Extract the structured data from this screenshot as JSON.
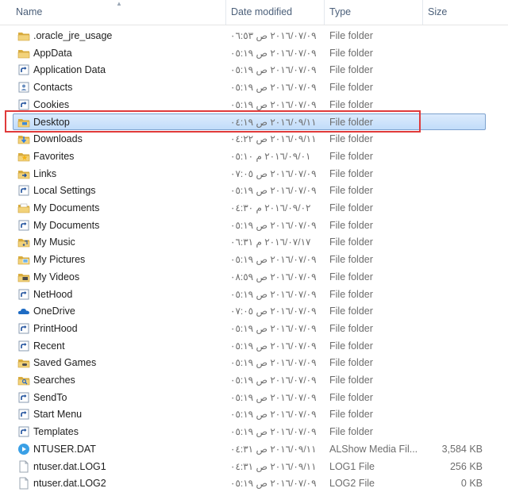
{
  "columns": {
    "name": "Name",
    "date": "Date modified",
    "type": "Type",
    "size": "Size"
  },
  "colors": {
    "annotation": "#e03a3a",
    "selection": "#c1dcfa",
    "folder": "#e8c462"
  },
  "files": [
    {
      "icon": "folder-icon",
      "name": ".oracle_jre_usage",
      "date": "٢٠١٦/٠٧/٠٩ ص ٠٦:٥٣",
      "type": "File folder",
      "size": ""
    },
    {
      "icon": "folder-icon",
      "name": "AppData",
      "date": "٢٠١٦/٠٧/٠٩ ص ٠٥:١٩",
      "type": "File folder",
      "size": ""
    },
    {
      "icon": "shortcut-folder-icon",
      "name": "Application Data",
      "date": "٢٠١٦/٠٧/٠٩ ص ٠٥:١٩",
      "type": "File folder",
      "size": ""
    },
    {
      "icon": "contacts-folder-icon",
      "name": "Contacts",
      "date": "٢٠١٦/٠٧/٠٩ ص ٠٥:١٩",
      "type": "File folder",
      "size": ""
    },
    {
      "icon": "shortcut-folder-icon",
      "name": "Cookies",
      "date": "٢٠١٦/٠٧/٠٩ ص ٠٥:١٩",
      "type": "File folder",
      "size": ""
    },
    {
      "icon": "desktop-folder-icon",
      "name": "Desktop",
      "date": "٢٠١٦/٠٩/١١ ص ٠٤:١٩",
      "type": "File folder",
      "size": "",
      "selected": true
    },
    {
      "icon": "downloads-folder-icon",
      "name": "Downloads",
      "date": "٢٠١٦/٠٩/١١ ص ٠٤:٢٢",
      "type": "File folder",
      "size": ""
    },
    {
      "icon": "favorites-folder-icon",
      "name": "Favorites",
      "date": "٢٠١٦/٠٩/٠١ م ٠٥:١٠",
      "type": "File folder",
      "size": ""
    },
    {
      "icon": "links-folder-icon",
      "name": "Links",
      "date": "٢٠١٦/٠٧/٠٩ ص ٠٧:٠٥",
      "type": "File folder",
      "size": ""
    },
    {
      "icon": "shortcut-folder-icon",
      "name": "Local Settings",
      "date": "٢٠١٦/٠٧/٠٩ ص ٠٥:١٩",
      "type": "File folder",
      "size": ""
    },
    {
      "icon": "documents-folder-icon",
      "name": "My Documents",
      "date": "٢٠١٦/٠٩/٠٢ م ٠٤:٣٠",
      "type": "File folder",
      "size": ""
    },
    {
      "icon": "shortcut-folder-icon",
      "name": "My Documents",
      "date": "٢٠١٦/٠٧/٠٩ ص ٠٥:١٩",
      "type": "File folder",
      "size": ""
    },
    {
      "icon": "music-folder-icon",
      "name": "My Music",
      "date": "٢٠١٦/٠٧/١٧ م ٠٦:٣١",
      "type": "File folder",
      "size": ""
    },
    {
      "icon": "pictures-folder-icon",
      "name": "My Pictures",
      "date": "٢٠١٦/٠٧/٠٩ ص ٠٥:١٩",
      "type": "File folder",
      "size": ""
    },
    {
      "icon": "videos-folder-icon",
      "name": "My Videos",
      "date": "٢٠١٦/٠٧/٠٩ ص ٠٨:٥٩",
      "type": "File folder",
      "size": ""
    },
    {
      "icon": "shortcut-folder-icon",
      "name": "NetHood",
      "date": "٢٠١٦/٠٧/٠٩ ص ٠٥:١٩",
      "type": "File folder",
      "size": ""
    },
    {
      "icon": "onedrive-cloud-icon",
      "name": "OneDrive",
      "date": "٢٠١٦/٠٧/٠٩ ص ٠٧:٠٥",
      "type": "File folder",
      "size": ""
    },
    {
      "icon": "shortcut-folder-icon",
      "name": "PrintHood",
      "date": "٢٠١٦/٠٧/٠٩ ص ٠٥:١٩",
      "type": "File folder",
      "size": ""
    },
    {
      "icon": "shortcut-folder-icon",
      "name": "Recent",
      "date": "٢٠١٦/٠٧/٠٩ ص ٠٥:١٩",
      "type": "File folder",
      "size": ""
    },
    {
      "icon": "saved-games-folder-icon",
      "name": "Saved Games",
      "date": "٢٠١٦/٠٧/٠٩ ص ٠٥:١٩",
      "type": "File folder",
      "size": ""
    },
    {
      "icon": "searches-folder-icon",
      "name": "Searches",
      "date": "٢٠١٦/٠٧/٠٩ ص ٠٥:١٩",
      "type": "File folder",
      "size": ""
    },
    {
      "icon": "shortcut-folder-icon",
      "name": "SendTo",
      "date": "٢٠١٦/٠٧/٠٩ ص ٠٥:١٩",
      "type": "File folder",
      "size": ""
    },
    {
      "icon": "shortcut-folder-icon",
      "name": "Start Menu",
      "date": "٢٠١٦/٠٧/٠٩ ص ٠٥:١٩",
      "type": "File folder",
      "size": ""
    },
    {
      "icon": "shortcut-folder-icon",
      "name": "Templates",
      "date": "٢٠١٦/٠٧/٠٩ ص ٠٥:١٩",
      "type": "File folder",
      "size": ""
    },
    {
      "icon": "media-file-icon",
      "name": "NTUSER.DAT",
      "date": "٢٠١٦/٠٩/١١ ص ٠٤:٣١",
      "type": "ALShow Media Fil...",
      "size": "3,584 KB"
    },
    {
      "icon": "file-icon",
      "name": "ntuser.dat.LOG1",
      "date": "٢٠١٦/٠٩/١١ ص ٠٤:٣١",
      "type": "LOG1 File",
      "size": "256 KB"
    },
    {
      "icon": "file-icon",
      "name": "ntuser.dat.LOG2",
      "date": "٢٠١٦/٠٧/٠٩ ص ٠٥:١٩",
      "type": "LOG2 File",
      "size": "0 KB"
    }
  ]
}
